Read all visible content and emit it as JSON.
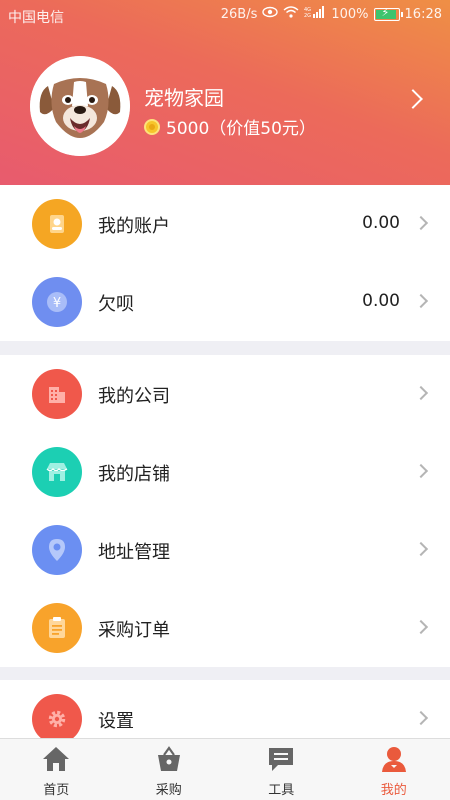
{
  "status_bar": {
    "carrier": "中国电信",
    "speed": "26B/s",
    "battery": "100%",
    "time": "16:28"
  },
  "profile": {
    "name": "宠物家园",
    "points_text": "5000（价值50元）"
  },
  "groups": [
    [
      {
        "label": "我的账户",
        "value": "0.00",
        "icon": "user-icon",
        "color": "#f5a623"
      },
      {
        "label": "欠呗",
        "value": "0.00",
        "icon": "yuan-icon",
        "color": "#6f8ef0"
      }
    ],
    [
      {
        "label": "我的公司",
        "icon": "building-icon",
        "color": "#f0584b"
      },
      {
        "label": "我的店铺",
        "icon": "store-icon",
        "color": "#1ccfb3"
      },
      {
        "label": "地址管理",
        "icon": "location-pin-icon",
        "color": "#6b8ff2"
      },
      {
        "label": "采购订单",
        "icon": "clipboard-icon",
        "color": "#f8a32b"
      }
    ],
    [
      {
        "label": "设置",
        "icon": "gear-icon",
        "color": "#f0584b"
      }
    ]
  ],
  "tabs": [
    {
      "label": "首页",
      "icon": "home-icon",
      "active": false
    },
    {
      "label": "采购",
      "icon": "basket-icon",
      "active": false
    },
    {
      "label": "工具",
      "icon": "message-icon",
      "active": false
    },
    {
      "label": "我的",
      "icon": "profile-icon",
      "active": true
    }
  ],
  "colors": {
    "accent": "#ea5a3c",
    "header_gradient_start": "#ef8f45",
    "header_gradient_end": "#e85b6e"
  }
}
